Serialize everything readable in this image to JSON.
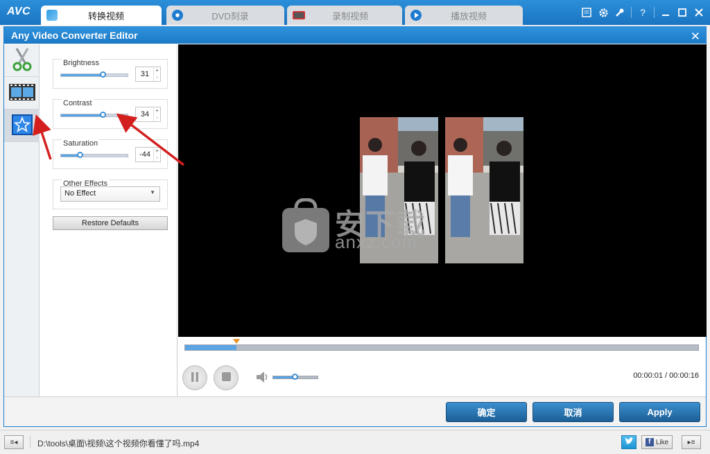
{
  "app": {
    "logo": "AVC"
  },
  "tabs": [
    {
      "label": "转换视频",
      "icon": "convert-icon",
      "active": true
    },
    {
      "label": "DVD刻录",
      "icon": "dvd-icon",
      "active": false
    },
    {
      "label": "录制视频",
      "icon": "record-icon",
      "active": false
    },
    {
      "label": "播放视频",
      "icon": "play-icon",
      "active": false
    }
  ],
  "window_controls": [
    "menu-icon",
    "settings-icon",
    "tools-icon",
    "help-icon",
    "minimize-icon",
    "maximize-icon",
    "close-icon"
  ],
  "window_control_glyphs": {
    "help": "?"
  },
  "dialog": {
    "title": "Any Video Converter Editor",
    "side_tabs": [
      "crop-scissors-icon",
      "clip-film-icon",
      "effects-star-icon"
    ],
    "brightness": {
      "label": "Brightness",
      "value": "31",
      "level": 0.62
    },
    "contrast": {
      "label": "Contrast",
      "value": "34",
      "level": 0.63
    },
    "saturation": {
      "label": "Saturation",
      "value": "-44",
      "level": 0.28
    },
    "other_effects": {
      "label": "Other Effects",
      "selected": "No Effect"
    },
    "restore_label": "Restore Defaults",
    "playback": {
      "progress": 0.1,
      "volume": 0.48,
      "time": "00:00:01 / 00:00:16"
    },
    "buttons": {
      "ok": "确定",
      "cancel": "取消",
      "apply": "Apply"
    }
  },
  "watermark": {
    "text_cn": "安下载",
    "text_en": "anxz.com"
  },
  "statusbar": {
    "path": "D:\\tools\\桌面\\视频\\这个视频你看懂了吗.mp4",
    "like_label": "Like"
  },
  "colors": {
    "accent": "#1d79c6",
    "slider": "#5aa4e4",
    "button": "#2a77b6",
    "annotation_arrow": "#d41f1f"
  }
}
